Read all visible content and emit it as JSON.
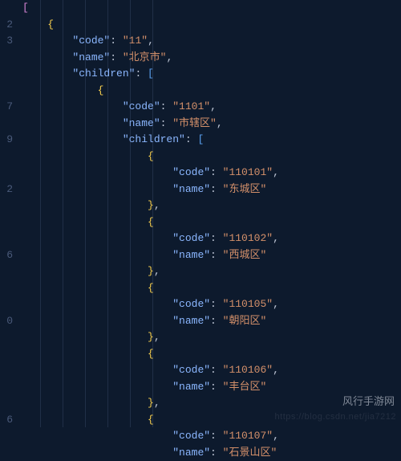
{
  "gutter": [
    "",
    "2",
    "3",
    "",
    "",
    "",
    "7",
    "",
    "9",
    "",
    "",
    "2",
    "",
    "",
    "",
    "6",
    "",
    "",
    "",
    "0",
    "",
    "",
    "",
    "",
    "",
    "6"
  ],
  "lines": [
    {
      "indent": 0,
      "kind": "open-bracket"
    },
    {
      "indent": 1,
      "kind": "open-brace"
    },
    {
      "indent": 2,
      "kind": "kv",
      "key": "code",
      "value": "11",
      "trail": ","
    },
    {
      "indent": 2,
      "kind": "kv",
      "key": "name",
      "value": "北京市",
      "trail": ","
    },
    {
      "indent": 2,
      "kind": "kv-open",
      "key": "children"
    },
    {
      "indent": 3,
      "kind": "open-brace"
    },
    {
      "indent": 4,
      "kind": "kv",
      "key": "code",
      "value": "1101",
      "trail": ","
    },
    {
      "indent": 4,
      "kind": "kv",
      "key": "name",
      "value": "市辖区",
      "trail": ","
    },
    {
      "indent": 4,
      "kind": "kv-open",
      "key": "children"
    },
    {
      "indent": 5,
      "kind": "open-brace"
    },
    {
      "indent": 6,
      "kind": "kv",
      "key": "code",
      "value": "110101",
      "trail": ","
    },
    {
      "indent": 6,
      "kind": "kv",
      "key": "name",
      "value": "东城区",
      "trail": ""
    },
    {
      "indent": 5,
      "kind": "close-brace",
      "trail": ","
    },
    {
      "indent": 5,
      "kind": "open-brace"
    },
    {
      "indent": 6,
      "kind": "kv",
      "key": "code",
      "value": "110102",
      "trail": ","
    },
    {
      "indent": 6,
      "kind": "kv",
      "key": "name",
      "value": "西城区",
      "trail": ""
    },
    {
      "indent": 5,
      "kind": "close-brace",
      "trail": ","
    },
    {
      "indent": 5,
      "kind": "open-brace"
    },
    {
      "indent": 6,
      "kind": "kv",
      "key": "code",
      "value": "110105",
      "trail": ","
    },
    {
      "indent": 6,
      "kind": "kv",
      "key": "name",
      "value": "朝阳区",
      "trail": ""
    },
    {
      "indent": 5,
      "kind": "close-brace",
      "trail": ","
    },
    {
      "indent": 5,
      "kind": "open-brace"
    },
    {
      "indent": 6,
      "kind": "kv",
      "key": "code",
      "value": "110106",
      "trail": ","
    },
    {
      "indent": 6,
      "kind": "kv",
      "key": "name",
      "value": "丰台区",
      "trail": ""
    },
    {
      "indent": 5,
      "kind": "close-brace",
      "trail": ","
    },
    {
      "indent": 5,
      "kind": "open-brace"
    },
    {
      "indent": 6,
      "kind": "kv",
      "key": "code",
      "value": "110107",
      "trail": ","
    },
    {
      "indent": 6,
      "kind": "kv",
      "key": "name",
      "value": "石景山区",
      "trail": ""
    }
  ],
  "indent_unit": "    ",
  "watermark": "https://blog.csdn.net/jia7212",
  "brand": "风行手游网"
}
